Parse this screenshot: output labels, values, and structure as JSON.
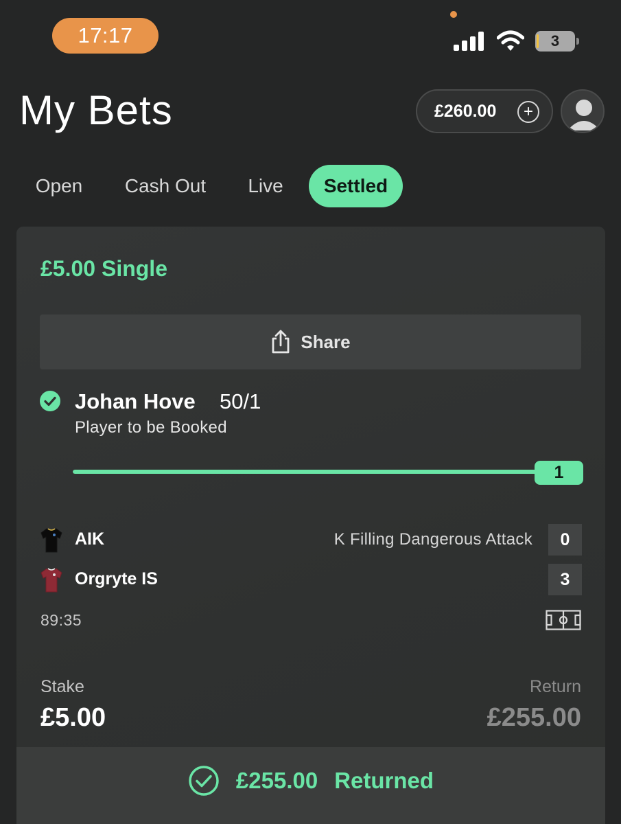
{
  "status_bar": {
    "time": "17:17",
    "battery_level": "3",
    "icons": [
      "signal-icon",
      "wifi-icon",
      "battery-icon"
    ]
  },
  "header": {
    "title": "My Bets",
    "balance": "£260.00",
    "icons": [
      "plus-circle-icon",
      "avatar-icon"
    ]
  },
  "tabs": [
    {
      "label": "Open",
      "active": false
    },
    {
      "label": "Cash Out",
      "active": false
    },
    {
      "label": "Live",
      "active": false
    },
    {
      "label": "Settled",
      "active": true
    }
  ],
  "bet": {
    "title": "£5.00 Single",
    "share_label": "Share",
    "selection": {
      "name": "Johan Hove",
      "odds": "50/1",
      "market": "Player to be Booked",
      "progress_value": "1",
      "progress_fraction": 1.0,
      "status_icon": "check-circle-icon"
    },
    "match": {
      "home_team": "AIK",
      "home_score": "0",
      "away_team": "Orgryte IS",
      "away_score": "3",
      "event_text": "K Filling Dangerous Attack",
      "clock": "89:35",
      "icons": [
        "home-shirt-icon",
        "away-shirt-icon",
        "pitch-icon"
      ]
    },
    "stake_label": "Stake",
    "stake_value": "£5.00",
    "return_label": "Return",
    "return_value": "£255.00",
    "returned_amount": "£255.00",
    "returned_label": "Returned"
  },
  "colors": {
    "accent": "#6ae5a6",
    "background": "#252626",
    "card": "#323433",
    "status_time_pill": "#e8944a"
  }
}
